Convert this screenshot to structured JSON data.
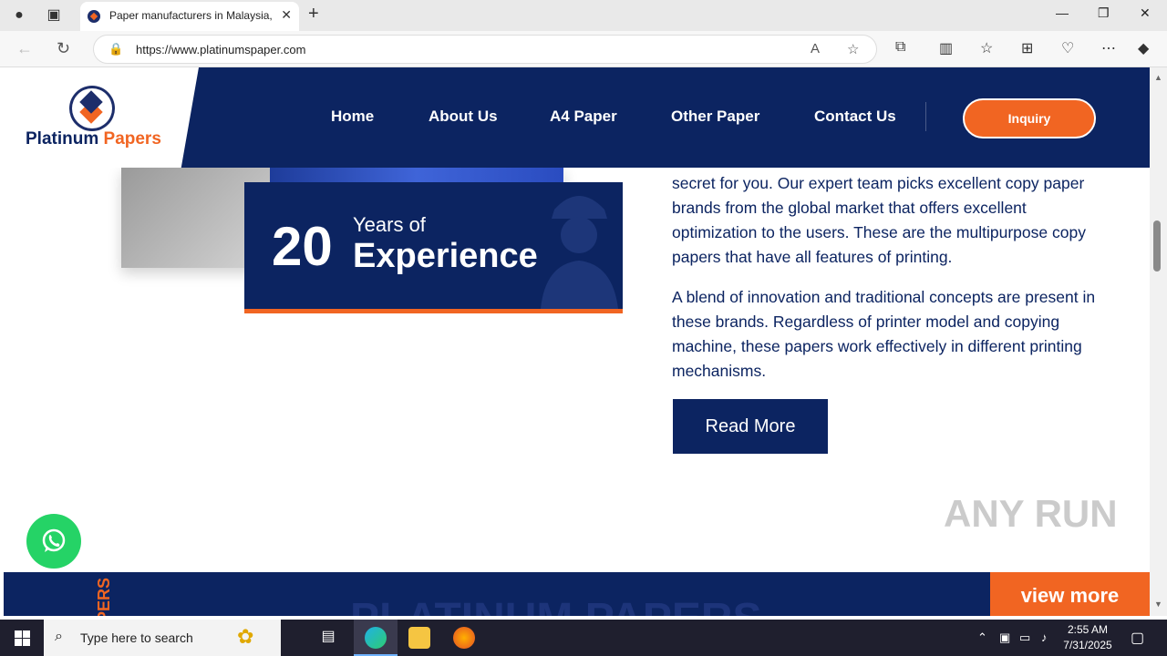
{
  "browser": {
    "tab_title": "Paper manufacturers in Malaysia,",
    "url": "https://www.platinumspaper.com"
  },
  "site": {
    "logo": {
      "line1": "Platinum",
      "line2": "Papers"
    },
    "nav": [
      "Home",
      "About Us",
      "A4 Paper",
      "Other Paper",
      "Contact Us"
    ],
    "inquiry": "Inquiry"
  },
  "experience": {
    "number": "20",
    "line1": "Years of",
    "line2": "Experience"
  },
  "content": {
    "p1": "secret for you. Our expert team picks excellent copy paper brands from the global market that offers excellent optimization to the users. These are the multipurpose copy papers that have all features of printing.",
    "p2": "A blend of innovation and traditional concepts are present in these brands. Regardless of printer model and copying machine, these papers work effectively in different printing mechanisms.",
    "read_more": "Read More"
  },
  "footer_band": {
    "vertical": "PERS",
    "ghost": "PLATINUM PAPERS",
    "view_more": "view more"
  },
  "watermark": "ANY RUN",
  "taskbar": {
    "search_placeholder": "Type here to search",
    "time": "2:55 AM",
    "date": "7/31/2025"
  },
  "colors": {
    "navy": "#0c2461",
    "orange": "#f16522",
    "whatsapp": "#25d366"
  }
}
